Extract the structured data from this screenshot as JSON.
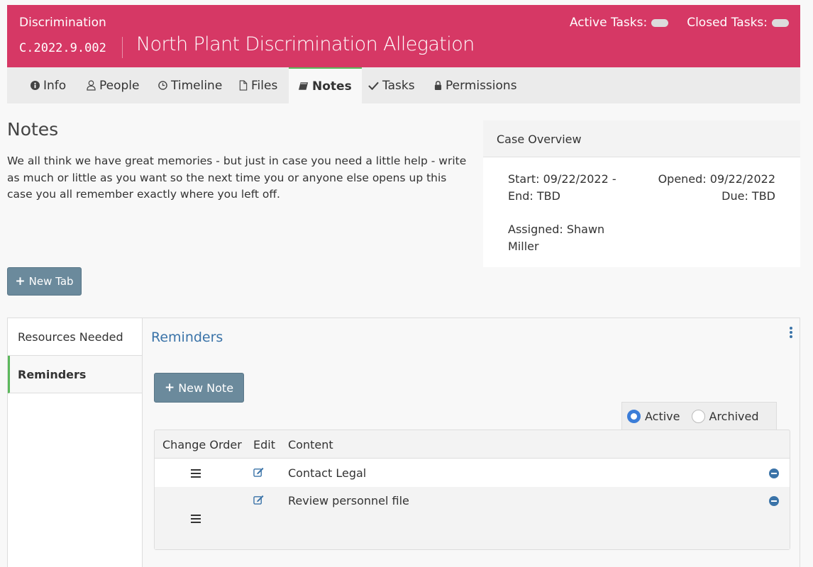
{
  "header": {
    "case_type": "Discrimination",
    "case_number": "C.2022.9.002",
    "case_title": "North Plant Discrimination Allegation",
    "active_tasks_label": "Active Tasks:",
    "closed_tasks_label": "Closed Tasks:"
  },
  "tabs": [
    {
      "label": "Info",
      "icon": "info-circle-icon"
    },
    {
      "label": "People",
      "icon": "user-icon"
    },
    {
      "label": "Timeline",
      "icon": "clock-icon"
    },
    {
      "label": "Files",
      "icon": "file-icon"
    },
    {
      "label": "Notes",
      "icon": "book-icon",
      "active": true
    },
    {
      "label": "Tasks",
      "icon": "check-icon"
    },
    {
      "label": "Permissions",
      "icon": "lock-icon"
    }
  ],
  "notes": {
    "title": "Notes",
    "description": "We all think we have great memories - but just in case you need a little help - write as much or little as you want so the next time you or anyone else opens up this case you all remember exactly where you left off."
  },
  "overview": {
    "title": "Case Overview",
    "start_line": "Start: 09/22/2022 -",
    "end_line": "End: TBD",
    "opened_line": "Opened: 09/22/2022",
    "due_line": "Due: TBD",
    "assigned_line": "Assigned: Shawn Miller"
  },
  "buttons": {
    "new_tab": "New Tab",
    "new_note": "New Note"
  },
  "side_tabs": [
    {
      "label": "Resources Needed"
    },
    {
      "label": "Reminders",
      "active": true
    }
  ],
  "panel": {
    "title": "Reminders",
    "status_options": [
      {
        "label": "Active",
        "checked": true
      },
      {
        "label": "Archived",
        "checked": false
      }
    ],
    "columns": [
      "Change Order",
      "Edit",
      "Content"
    ],
    "rows": [
      {
        "content": "Contact Legal"
      },
      {
        "content": "Review personnel file"
      }
    ]
  },
  "colors": {
    "header_bg": "#d63865",
    "accent_green": "#5cb85c",
    "link_blue": "#3a73a8",
    "button_bg": "#6b8a9c"
  }
}
